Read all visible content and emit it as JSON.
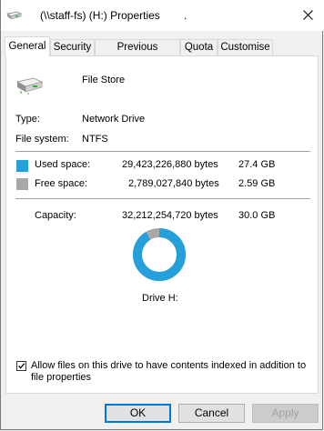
{
  "window": {
    "title": "(\\\\staff-fs) (H:) Properties",
    "title_extra": "."
  },
  "tabs": [
    {
      "label": "General"
    },
    {
      "label": "Security"
    },
    {
      "label": "Previous Versions"
    },
    {
      "label": "Quota"
    },
    {
      "label": "Customise"
    }
  ],
  "drive": {
    "name": "File Store",
    "type_label": "Type:",
    "type_value": "Network Drive",
    "fs_label": "File system:",
    "fs_value": "NTFS"
  },
  "space": {
    "used_label": "Used space:",
    "used_bytes": "29,423,226,880 bytes",
    "used_gb": "27.4 GB",
    "used_color": "#26a0da",
    "free_label": "Free space:",
    "free_bytes": "2,789,027,840 bytes",
    "free_gb": "2.59 GB",
    "free_color": "#a8a8a8",
    "capacity_label": "Capacity:",
    "capacity_bytes": "32,212,254,720 bytes",
    "capacity_gb": "30.0 GB",
    "used_fraction": 0.9134
  },
  "drive_caption": "Drive H:",
  "index_checkbox": {
    "checked": true,
    "label_line1": "Allow files on this drive to have contents indexed in addition to",
    "label_line2": "file properties"
  },
  "buttons": {
    "ok": "OK",
    "cancel": "Cancel",
    "apply": "Apply"
  }
}
